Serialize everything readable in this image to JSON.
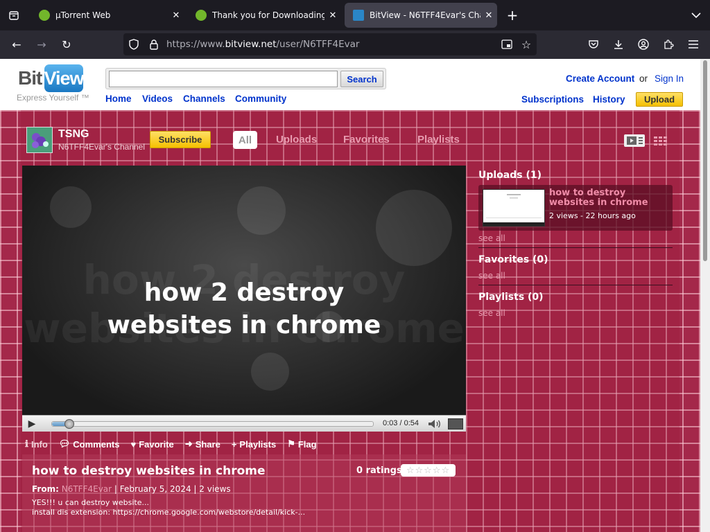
{
  "browser": {
    "tabs": [
      {
        "title": "µTorrent Web",
        "active": false
      },
      {
        "title": "Thank you for Downloading µTorrent",
        "active": false
      },
      {
        "title": "BitView - N6TFF4Evar's Channel",
        "active": true
      }
    ],
    "url_prefix": "https://www.",
    "url_domain": "bitview.net",
    "url_path": "/user/N6TFF4Evar"
  },
  "site": {
    "logo_bit": "Bit",
    "logo_view": "View",
    "tagline": "Express Yourself ™",
    "search_button": "Search",
    "search_value": "",
    "nav": [
      "Home",
      "Videos",
      "Channels",
      "Community"
    ],
    "create_account": "Create Account",
    "or": "or",
    "sign_in": "Sign In",
    "subscriptions": "Subscriptions",
    "history": "History",
    "upload": "Upload"
  },
  "channel": {
    "name": "TSNG",
    "subtitle": "N6TFF4Evar's Channel",
    "subscribe": "Subscribe",
    "tabs": [
      "All",
      "Uploads",
      "Favorites",
      "Playlists"
    ],
    "active_tab": "All",
    "bg_color": "#a4284a"
  },
  "player": {
    "overlay_line1": "how 2 destroy",
    "overlay_line2": "websites in chrome",
    "time": "0:03 / 0:54",
    "progress": 0.055
  },
  "actions": [
    "Info",
    "Comments",
    "Favorite",
    "Share",
    "Playlists",
    "Flag"
  ],
  "video": {
    "title": "how to destroy websites in chrome",
    "ratings": "0 ratings",
    "from_label": "From:",
    "author": "N6TFF4Evar",
    "date": "February 5, 2024",
    "views": "2 views",
    "desc_line1": "YES!!! u can destroy website...",
    "desc_line2": "install dis extension: https://chrome.google.com/webstore/detail/kick-..."
  },
  "sidebar": {
    "uploads_heading": "Uploads (1)",
    "upload_card": {
      "title": "how to destroy websites in chrome",
      "meta": "2 views - 22 hours ago"
    },
    "favorites_heading": "Favorites (0)",
    "playlists_heading": "Playlists (0)",
    "see_all": "see all"
  }
}
